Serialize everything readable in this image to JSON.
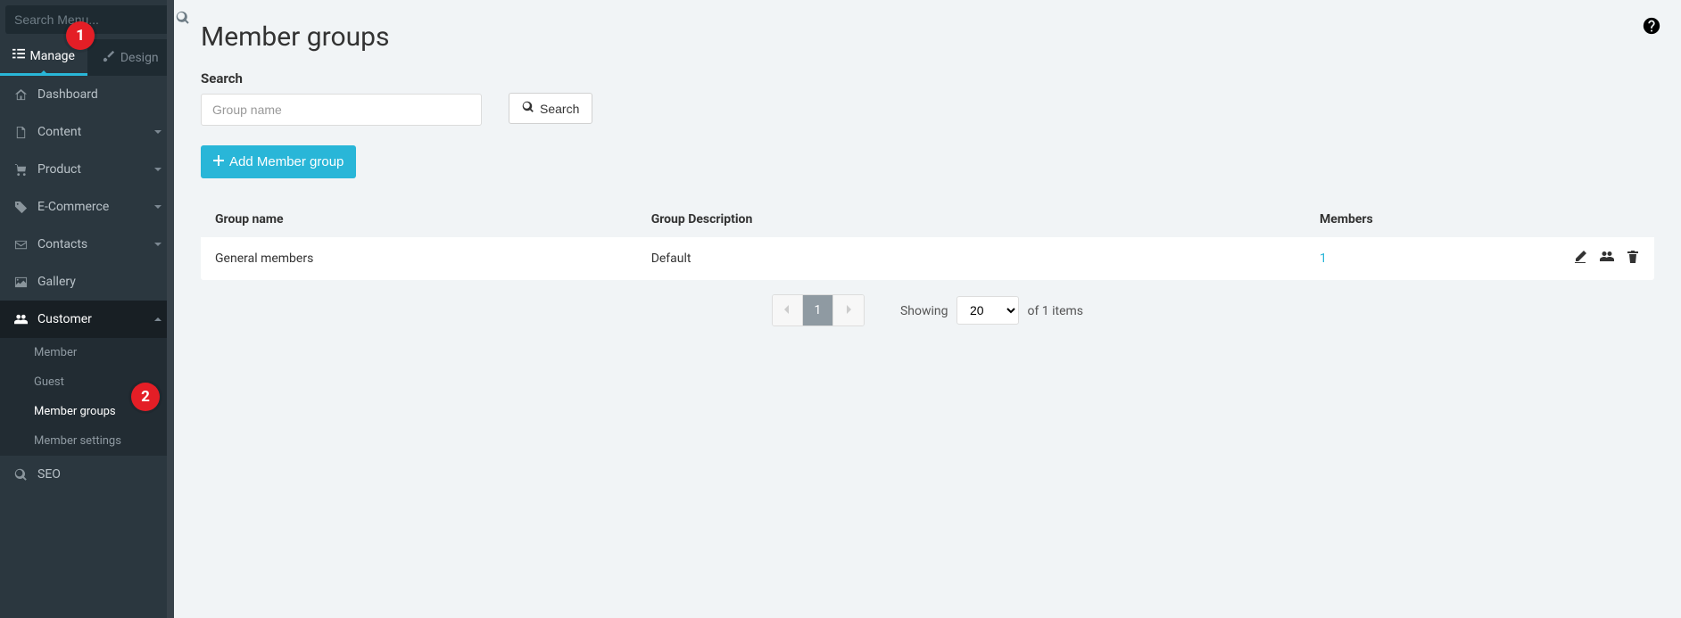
{
  "sidebar": {
    "search_placeholder": "Search Menu...",
    "tabs": {
      "manage": "Manage",
      "design": "Design"
    },
    "items": [
      {
        "label": "Dashboard"
      },
      {
        "label": "Content"
      },
      {
        "label": "Product"
      },
      {
        "label": "E-Commerce"
      },
      {
        "label": "Contacts"
      },
      {
        "label": "Gallery"
      },
      {
        "label": "Customer"
      },
      {
        "label": "SEO"
      }
    ],
    "customer_children": [
      {
        "label": "Member"
      },
      {
        "label": "Guest"
      },
      {
        "label": "Member groups"
      },
      {
        "label": "Member settings"
      }
    ]
  },
  "annotations": {
    "step1": "1",
    "step2": "2"
  },
  "page": {
    "title": "Member groups",
    "search_label": "Search",
    "search_placeholder": "Group name",
    "search_button": "Search",
    "add_button": "Add Member group"
  },
  "table": {
    "columns": {
      "name": "Group name",
      "desc": "Group Description",
      "members": "Members"
    },
    "rows": [
      {
        "name": "General members",
        "desc": "Default",
        "members": "1"
      }
    ]
  },
  "pagination": {
    "current": "1",
    "showing_prefix": "Showing",
    "page_size": "20",
    "showing_suffix": "of 1 items"
  }
}
